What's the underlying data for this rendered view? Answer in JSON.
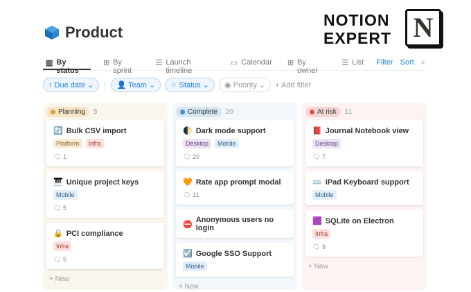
{
  "title": "Product",
  "brand": {
    "line1": "NOTION",
    "line2": "EXPERT",
    "logo": "N"
  },
  "tabs": [
    {
      "icon": "board-icon",
      "label": "By status"
    },
    {
      "icon": "table-icon",
      "label": "By sprint"
    },
    {
      "icon": "timeline-icon",
      "label": "Launch timeline"
    },
    {
      "icon": "calendar-icon",
      "label": "Calendar"
    },
    {
      "icon": "gallery-icon",
      "label": "By owner"
    },
    {
      "icon": "list-icon",
      "label": "List"
    }
  ],
  "actions": {
    "filter": "Filter",
    "sort": "Sort"
  },
  "filters": {
    "due": "↑ Due date ⌄",
    "team": "👤 Team ⌄",
    "status": "⁘ Status ⌄",
    "priority": "◉ Priority ⌄",
    "add": "+ Add filter"
  },
  "colors": {
    "accent": "#2383e2"
  },
  "columns": [
    {
      "name": "Planning",
      "count": "5",
      "dot": "#d9a33a",
      "pill": "#f6e5c6",
      "cards": [
        {
          "icon": "🔄",
          "title": "Bulk CSV import",
          "tags": [
            {
              "t": "Platform",
              "bg": "#f8ecd6",
              "c": "#8a6a2a"
            },
            {
              "t": "Infra",
              "bg": "#fbe0de",
              "c": "#a8453c"
            }
          ],
          "comments": "1"
        },
        {
          "icon": "🎹",
          "title": "Unique project keys",
          "tags": [
            {
              "t": "Mobile",
              "bg": "#e4eef8",
              "c": "#2f5f8a"
            }
          ],
          "comments": "5"
        },
        {
          "icon": "🔒",
          "title": "PCI compliance",
          "tags": [
            {
              "t": "Infra",
              "bg": "#fbe0de",
              "c": "#a8453c"
            }
          ],
          "comments": "5"
        }
      ]
    },
    {
      "name": "Complete",
      "count": "20",
      "dot": "#4e8ec4",
      "pill": "#d6e6f3",
      "cards": [
        {
          "icon": "🌓",
          "title": "Dark mode support",
          "tags": [
            {
              "t": "Desktop",
              "bg": "#ece2f3",
              "c": "#6a3f8a"
            },
            {
              "t": "Mobile",
              "bg": "#e4eef8",
              "c": "#2f5f8a"
            }
          ],
          "comments": "20"
        },
        {
          "icon": "🧡",
          "title": "Rate app prompt modal",
          "tags": [],
          "comments": "11"
        },
        {
          "icon": "⛔",
          "title": "Anonymous users no login",
          "tags": [],
          "comments": null
        },
        {
          "icon": "☑️",
          "title": "Google SSO Support",
          "tags": [
            {
              "t": "Mobile",
              "bg": "#e4eef8",
              "c": "#2f5f8a"
            }
          ],
          "comments": null
        }
      ]
    },
    {
      "name": "At risk",
      "count": "11",
      "dot": "#d9534f",
      "pill": "#f6d6d3",
      "cards": [
        {
          "icon": "📕",
          "title": "Journal Notebook view",
          "tags": [
            {
              "t": "Desktop",
              "bg": "#ece2f3",
              "c": "#6a3f8a"
            }
          ],
          "comments": "7"
        },
        {
          "icon": "⌨️",
          "title": "iPad Keyboard support",
          "tags": [
            {
              "t": "Mobile",
              "bg": "#e4eef8",
              "c": "#2f5f8a"
            }
          ],
          "comments": null
        },
        {
          "icon": "🟪",
          "title": "SQLite on Electron",
          "tags": [
            {
              "t": "Infra",
              "bg": "#fbe0de",
              "c": "#a8453c"
            }
          ],
          "comments": "9"
        }
      ]
    }
  ],
  "new_label": "+ New"
}
